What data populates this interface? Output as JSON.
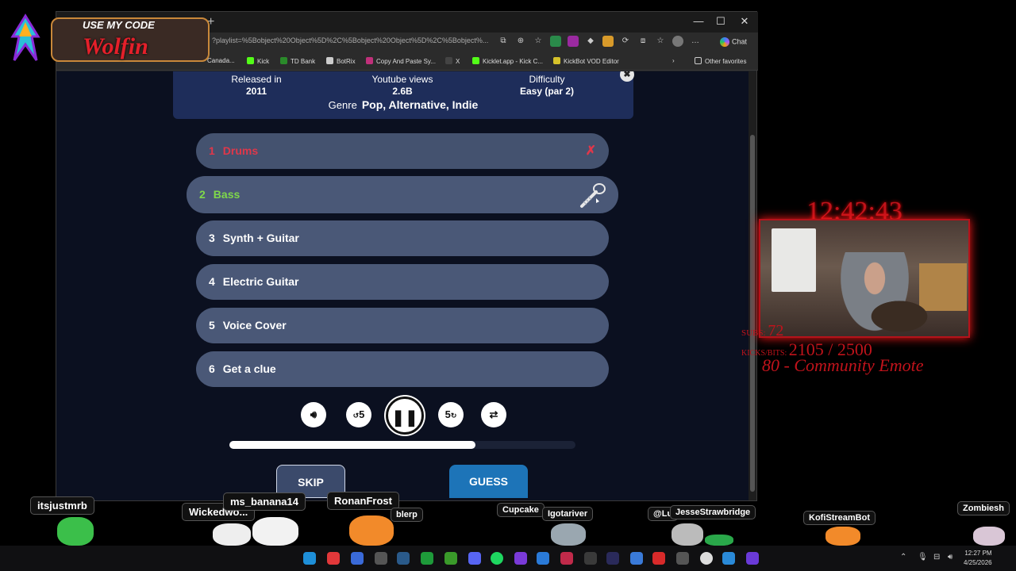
{
  "overlay": {
    "code_top": "USE MY CODE",
    "code_name": "Wolfin",
    "clock": "12:42:43",
    "subs_label": "SUBS:",
    "subs_value": "72",
    "kicks_label": "KICKS/BITS:",
    "kicks_value": "2105 / 2500",
    "emote_goal": "80 - Community Emote"
  },
  "browser": {
    "url": "?playlist=%5Bobject%20Object%5D%2C%5Bobject%20Object%5D%2C%5Bobject%...",
    "chat_label": "Chat",
    "bookmarks": [
      "Canada...",
      "Kick",
      "TD Bank",
      "BotRix",
      "Copy And Paste Sy...",
      "X",
      "Kicklet.app - Kick C...",
      "KickBot VOD Editor"
    ],
    "other_favorites": "Other favorites"
  },
  "song": {
    "released_label": "Released in",
    "released_value": "2011",
    "views_label": "Youtube views",
    "views_value": "2.6B",
    "difficulty_label": "Difficulty",
    "difficulty_value": "Easy (par 2)",
    "genre_label": "Genre",
    "genre_value": "Pop, Alternative, Indie"
  },
  "options": [
    {
      "num": "1",
      "label": "Drums",
      "state": "wrong"
    },
    {
      "num": "2",
      "label": "Bass",
      "state": "current"
    },
    {
      "num": "3",
      "label": "Synth + Guitar",
      "state": "locked"
    },
    {
      "num": "4",
      "label": "Electric Guitar",
      "state": "locked"
    },
    {
      "num": "5",
      "label": "Voice Cover",
      "state": "locked"
    },
    {
      "num": "6",
      "label": "Get a clue",
      "state": "locked"
    }
  ],
  "player": {
    "progress": 0.71,
    "rewind_label": "5",
    "forward_label": "5"
  },
  "buttons": {
    "skip": "SKIP",
    "guess": "GUESS"
  },
  "chatters": [
    "itsjustmrb",
    "Wickedwo...",
    "ms_banana14",
    "RonanFrost",
    "blerp",
    "Cupcake",
    "Igotariver",
    "@Lu",
    "JesseStrawbridge",
    "KofiStreamBot",
    "Zombiesh"
  ],
  "taskbar": {
    "time": "12:27 PM",
    "date": "4/25/2026"
  },
  "colors": {
    "wrong": "#e0374a",
    "current": "#7fd84a",
    "option_bg": "#4a5877",
    "guess_bg": "#1d74b8",
    "overlay_red": "#c0131b"
  }
}
